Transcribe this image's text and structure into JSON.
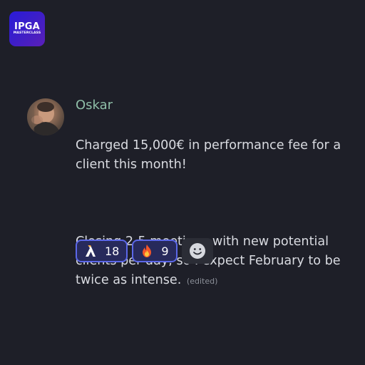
{
  "logo": {
    "main": "IPGA",
    "sub": "MASTERCLASS"
  },
  "message": {
    "author": "Oskar",
    "line1": "Charged 15,000€ in performance fee for a client this month!",
    "line2": "Closing 2-5 meetings with new potential clients per day, so I expect February to be twice as intense.",
    "edited": "(edited)"
  },
  "reactions": [
    {
      "icon": "lambda-logo-icon",
      "count": "18"
    },
    {
      "icon": "fire-icon",
      "count": "9"
    }
  ],
  "add_reaction_icon": "smiley-face-icon",
  "colors": {
    "background": "#1e1f28",
    "username": "#8fbfa8",
    "reaction_border": "#5b67e8",
    "reaction_bg": "#272a5b"
  }
}
